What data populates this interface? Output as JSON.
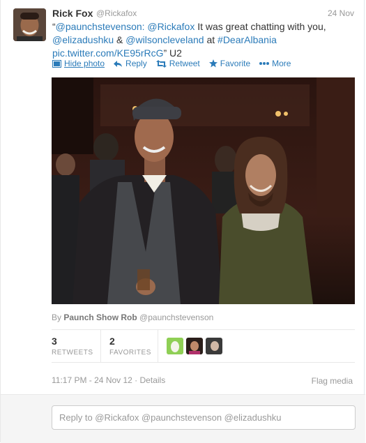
{
  "tweet": {
    "name": "Rick Fox",
    "handle": "@Rickafox",
    "date": "24 Nov",
    "text": {
      "quote_open": "“",
      "mention1": "@paunchstevenson:",
      "mention2": "@Rickafox",
      "plain1": " It was great chatting with you, ",
      "mention3": "@elizadushku",
      "plain2": " & ",
      "mention4": "@wilsoncleveland",
      "plain3": " at ",
      "hashtag": "#DearAlbania",
      "piclink": "pic.twitter.com/KE95rRcG",
      "plain4": "” U2"
    }
  },
  "actions": {
    "hide_photo": "Hide photo",
    "reply": "Reply",
    "retweet": "Retweet",
    "favorite": "Favorite",
    "more": "More"
  },
  "byline": {
    "prefix": "By",
    "name": "Paunch Show Rob",
    "handle": "@paunchstevenson"
  },
  "stats": {
    "retweets_count": "3",
    "retweets_label": "RETWEETS",
    "favorites_count": "2",
    "favorites_label": "FAVORITES"
  },
  "meta": {
    "timestamp": "11:17 PM - 24 Nov 12",
    "separator": " · ",
    "details": "Details",
    "flag": "Flag media"
  },
  "reply": {
    "placeholder": "Reply to @Rickafox @paunchstevenson @elizadushku"
  },
  "colors": {
    "link": "#2b7bb9",
    "muted": "#999999"
  },
  "icons": [
    "photo-icon",
    "reply-icon",
    "retweet-icon",
    "star-icon",
    "more-dots-icon"
  ]
}
